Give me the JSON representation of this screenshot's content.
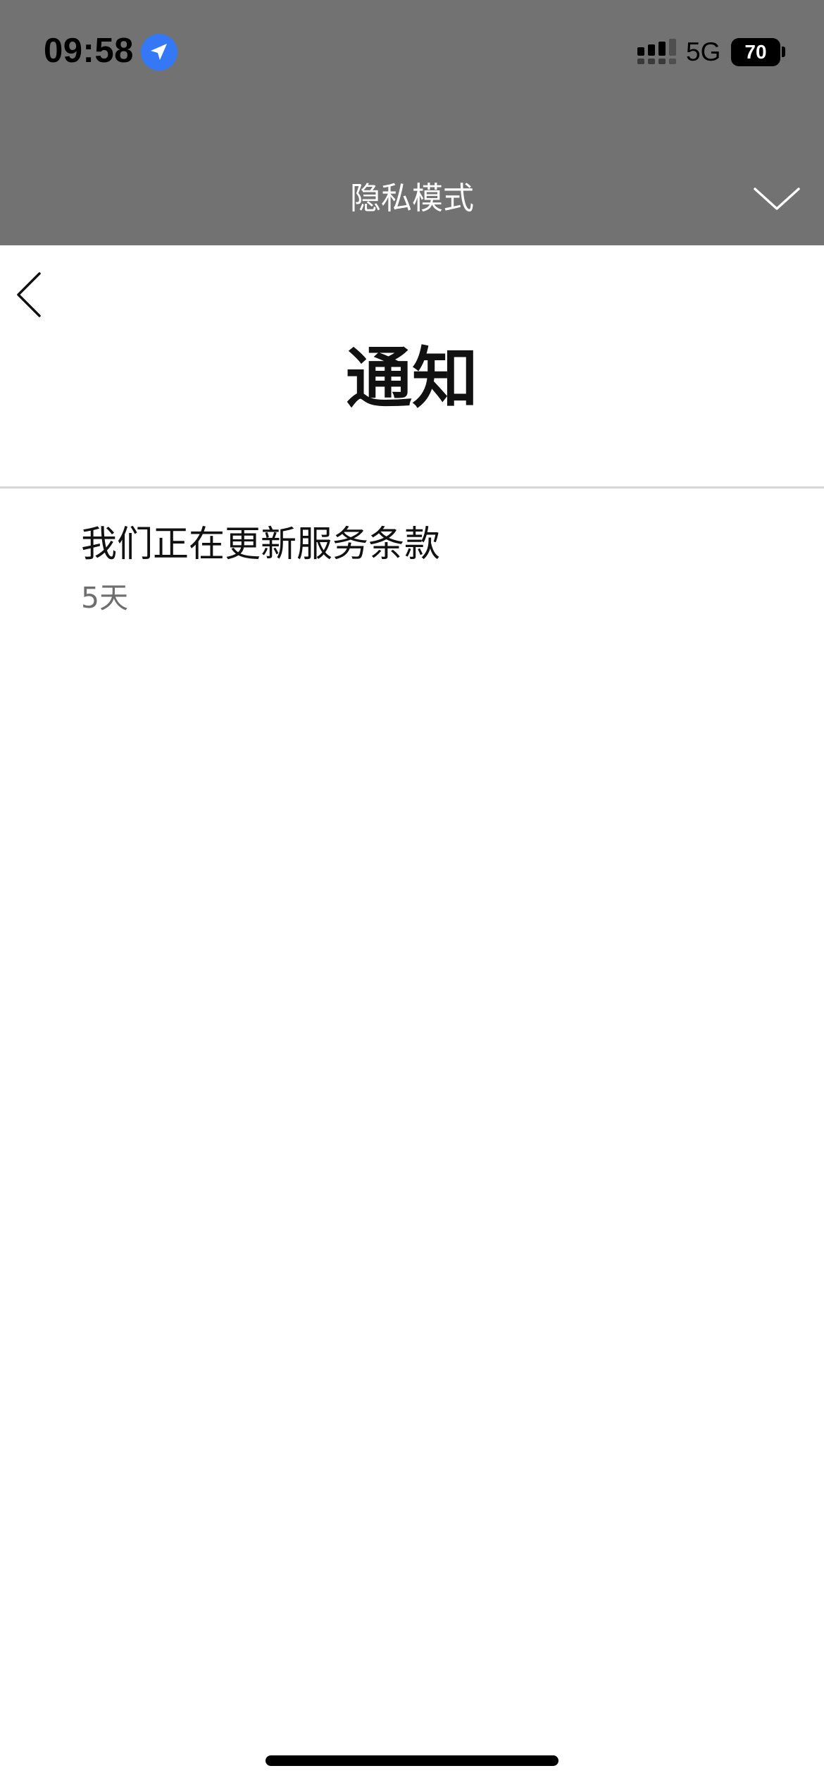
{
  "status_bar": {
    "time": "09:58",
    "location_icon": "location-arrow-icon",
    "signal_icon": "cellular-signal-icon",
    "network": "5G",
    "battery_level": "70",
    "battery_icon": "battery-icon"
  },
  "privacy_banner": {
    "title": "隐私模式",
    "chevron_icon": "chevron-down-icon",
    "background_color": "#727272"
  },
  "header": {
    "back_icon": "chevron-left-icon",
    "title": "通知"
  },
  "notifications": [
    {
      "title": "我们正在更新服务条款",
      "time": "5天"
    }
  ],
  "colors": {
    "location_accent": "#3478f6",
    "secondary_text": "#6e6e6e"
  }
}
